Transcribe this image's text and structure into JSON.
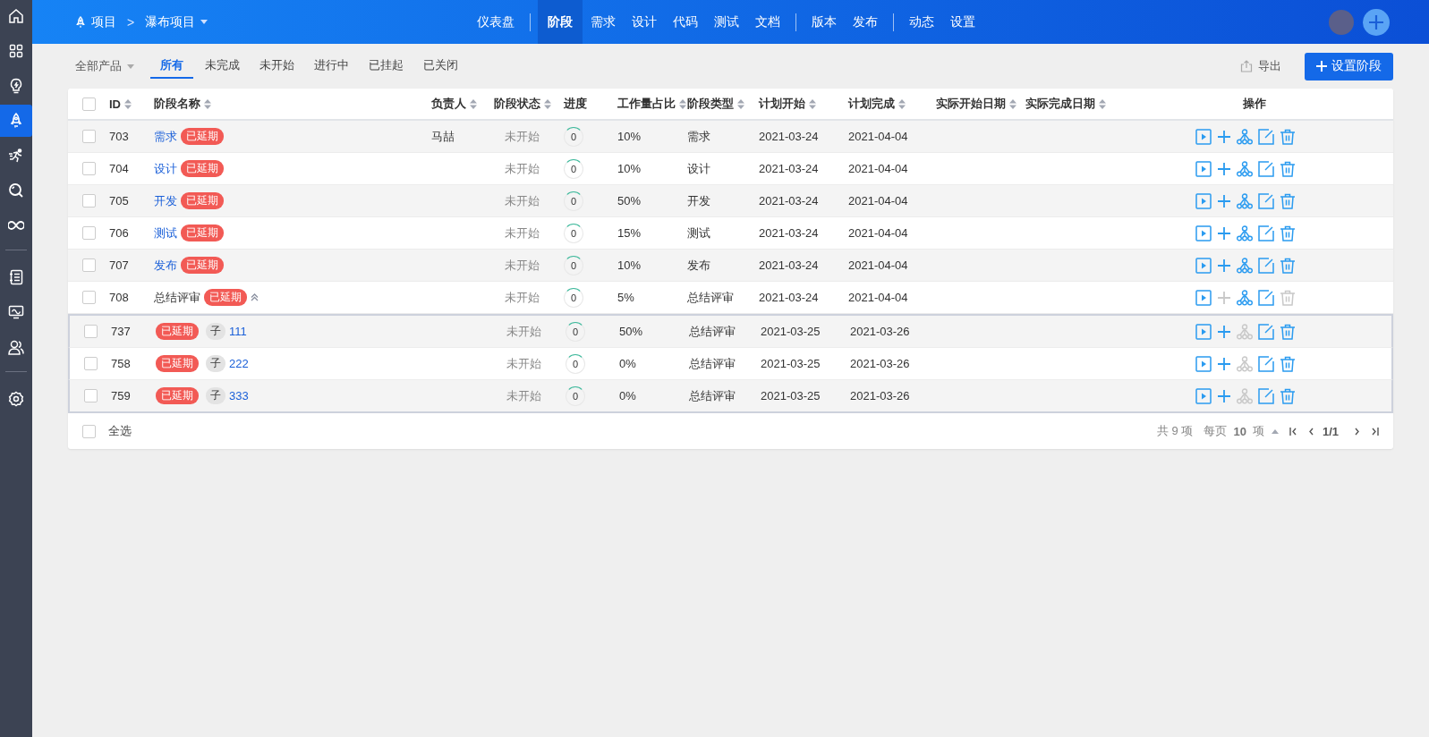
{
  "topbar": {
    "breadcrumb": {
      "root": "项目",
      "separator": ">",
      "current": "瀑布项目"
    },
    "nav_groups": [
      [
        {
          "label": "仪表盘",
          "selected": false
        }
      ],
      [
        {
          "label": "阶段",
          "selected": true
        },
        {
          "label": "需求",
          "selected": false
        },
        {
          "label": "设计",
          "selected": false
        },
        {
          "label": "代码",
          "selected": false
        },
        {
          "label": "测试",
          "selected": false
        },
        {
          "label": "文档",
          "selected": false
        }
      ],
      [
        {
          "label": "版本",
          "selected": false
        },
        {
          "label": "发布",
          "selected": false
        }
      ],
      [
        {
          "label": "动态",
          "selected": false
        },
        {
          "label": "设置",
          "selected": false
        }
      ]
    ]
  },
  "sidebar": {
    "groups": [
      [
        {
          "selected": false
        },
        {
          "selected": false
        },
        {
          "selected": false
        },
        {
          "selected": true
        },
        {
          "selected": false
        },
        {
          "selected": false
        },
        {
          "selected": false
        }
      ],
      [
        {
          "selected": false
        },
        {
          "selected": false
        },
        {
          "selected": false
        }
      ],
      [
        {
          "selected": false
        }
      ]
    ]
  },
  "filter_bar": {
    "product": "全部产品",
    "tabs": [
      {
        "label": "所有",
        "selected": true
      },
      {
        "label": "未完成",
        "selected": false
      },
      {
        "label": "未开始",
        "selected": false
      },
      {
        "label": "进行中",
        "selected": false
      },
      {
        "label": "已挂起",
        "selected": false
      },
      {
        "label": "已关闭",
        "selected": false
      }
    ],
    "export": "导出",
    "create": "设置阶段"
  },
  "table": {
    "header_checked": false,
    "columns": [
      {
        "label": "ID",
        "sortable": true
      },
      {
        "label": "阶段名称",
        "sortable": true
      },
      {
        "label": "负责人",
        "sortable": true
      },
      {
        "label": "阶段状态",
        "sortable": true
      },
      {
        "label": "进度",
        "sortable": false
      },
      {
        "label": "工作量占比",
        "sortable": true
      },
      {
        "label": "阶段类型",
        "sortable": true
      },
      {
        "label": "计划开始",
        "sortable": true
      },
      {
        "label": "计划完成",
        "sortable": true
      },
      {
        "label": "实际开始日期",
        "sortable": true
      },
      {
        "label": "实际完成日期",
        "sortable": true
      },
      {
        "label": "操作",
        "sortable": false
      }
    ],
    "rows": [
      {
        "id": "703",
        "name": "需求",
        "kind": "stage",
        "badge": "已延期",
        "owner": "马喆",
        "status": "未开始",
        "progress": "0",
        "workload": "10%",
        "type": "需求",
        "plan_start": "2021-03-24",
        "plan_end": "2021-04-04",
        "checked": false,
        "add_disabled": false,
        "split_disabled": false,
        "delete_disabled": false
      },
      {
        "id": "704",
        "name": "设计",
        "kind": "stage",
        "badge": "已延期",
        "status": "未开始",
        "progress": "0",
        "workload": "10%",
        "type": "设计",
        "plan_start": "2021-03-24",
        "plan_end": "2021-04-04",
        "checked": false,
        "add_disabled": false,
        "split_disabled": false,
        "delete_disabled": false
      },
      {
        "id": "705",
        "name": "开发",
        "kind": "stage",
        "badge": "已延期",
        "status": "未开始",
        "progress": "0",
        "workload": "50%",
        "type": "开发",
        "plan_start": "2021-03-24",
        "plan_end": "2021-04-04",
        "checked": false,
        "add_disabled": false,
        "split_disabled": false,
        "delete_disabled": false
      },
      {
        "id": "706",
        "name": "测试",
        "kind": "stage",
        "badge": "已延期",
        "status": "未开始",
        "progress": "0",
        "workload": "15%",
        "type": "测试",
        "plan_start": "2021-03-24",
        "plan_end": "2021-04-04",
        "checked": false,
        "add_disabled": false,
        "split_disabled": false,
        "delete_disabled": false
      },
      {
        "id": "707",
        "name": "发布",
        "kind": "stage",
        "badge": "已延期",
        "status": "未开始",
        "progress": "0",
        "workload": "10%",
        "type": "发布",
        "plan_start": "2021-03-24",
        "plan_end": "2021-04-04",
        "checked": false,
        "add_disabled": false,
        "split_disabled": false,
        "delete_disabled": false
      },
      {
        "id": "708",
        "name": "总结评审",
        "kind": "parent",
        "badge": "已延期",
        "expanded": true,
        "status": "未开始",
        "progress": "0",
        "workload": "5%",
        "type": "总结评审",
        "plan_start": "2021-03-24",
        "plan_end": "2021-04-04",
        "checked": false,
        "add_disabled": true,
        "split_disabled": false,
        "delete_disabled": true,
        "children": [
          {
            "id": "737",
            "name": "111",
            "kind": "child",
            "badge": "已延期",
            "tag": "子",
            "status": "未开始",
            "progress": "0",
            "workload": "50%",
            "type": "总结评审",
            "plan_start": "2021-03-25",
            "plan_end": "2021-03-26",
            "checked": false,
            "add_disabled": false,
            "split_disabled": true,
            "delete_disabled": false
          },
          {
            "id": "758",
            "name": "222",
            "kind": "child",
            "badge": "已延期",
            "tag": "子",
            "status": "未开始",
            "progress": "0",
            "workload": "0%",
            "type": "总结评审",
            "plan_start": "2021-03-25",
            "plan_end": "2021-03-26",
            "checked": false,
            "add_disabled": false,
            "split_disabled": true,
            "delete_disabled": false
          },
          {
            "id": "759",
            "name": "333",
            "kind": "child",
            "badge": "已延期",
            "tag": "子",
            "status": "未开始",
            "progress": "0",
            "workload": "0%",
            "type": "总结评审",
            "plan_start": "2021-03-25",
            "plan_end": "2021-03-26",
            "checked": false,
            "add_disabled": false,
            "split_disabled": true,
            "delete_disabled": false
          }
        ]
      }
    ]
  },
  "footer": {
    "select_all": {
      "label": "全选",
      "checked": false
    },
    "total": "共 9 项",
    "per_page_label": "每页",
    "per_page": "10",
    "per_page_unit": "项",
    "page": "1/1"
  }
}
